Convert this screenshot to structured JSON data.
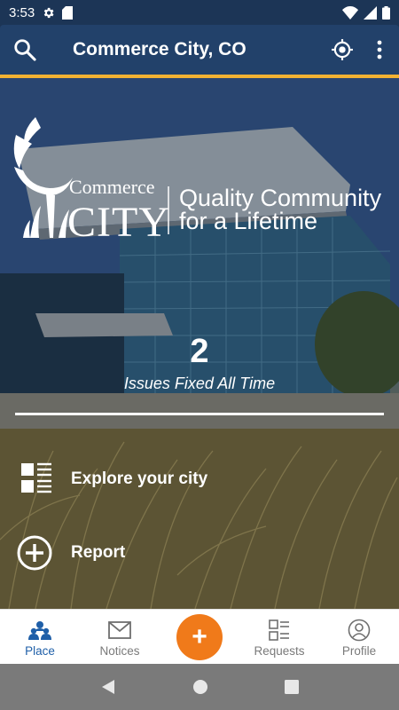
{
  "status_bar": {
    "time": "3:53",
    "icons_left": [
      "gear-icon",
      "sd-card-icon"
    ],
    "icons_right": [
      "wifi-icon",
      "signal-icon",
      "battery-icon"
    ]
  },
  "app_bar": {
    "title": "Commerce City, CO",
    "search_icon": "search-icon",
    "location_icon": "my-location-icon",
    "menu_icon": "more-vert-icon"
  },
  "colors": {
    "header": "#22416a",
    "accent_line": "#f2b233",
    "fab": "#f07a1a",
    "active_nav": "#1f5fa8"
  },
  "logo": {
    "brand_top": "Commerce",
    "brand_bottom": "CITY",
    "tagline_line1": "Quality Community",
    "tagline_line2": "for a Lifetime"
  },
  "stats": {
    "count": "2",
    "label": "Issues Fixed All Time"
  },
  "actions": {
    "explore_label": "Explore your city",
    "report_label": "Report"
  },
  "bottom_nav": {
    "place": "Place",
    "notices": "Notices",
    "fab_symbol": "+",
    "requests": "Requests",
    "profile": "Profile"
  },
  "system_nav": [
    "back-icon",
    "home-icon",
    "recents-icon"
  ]
}
